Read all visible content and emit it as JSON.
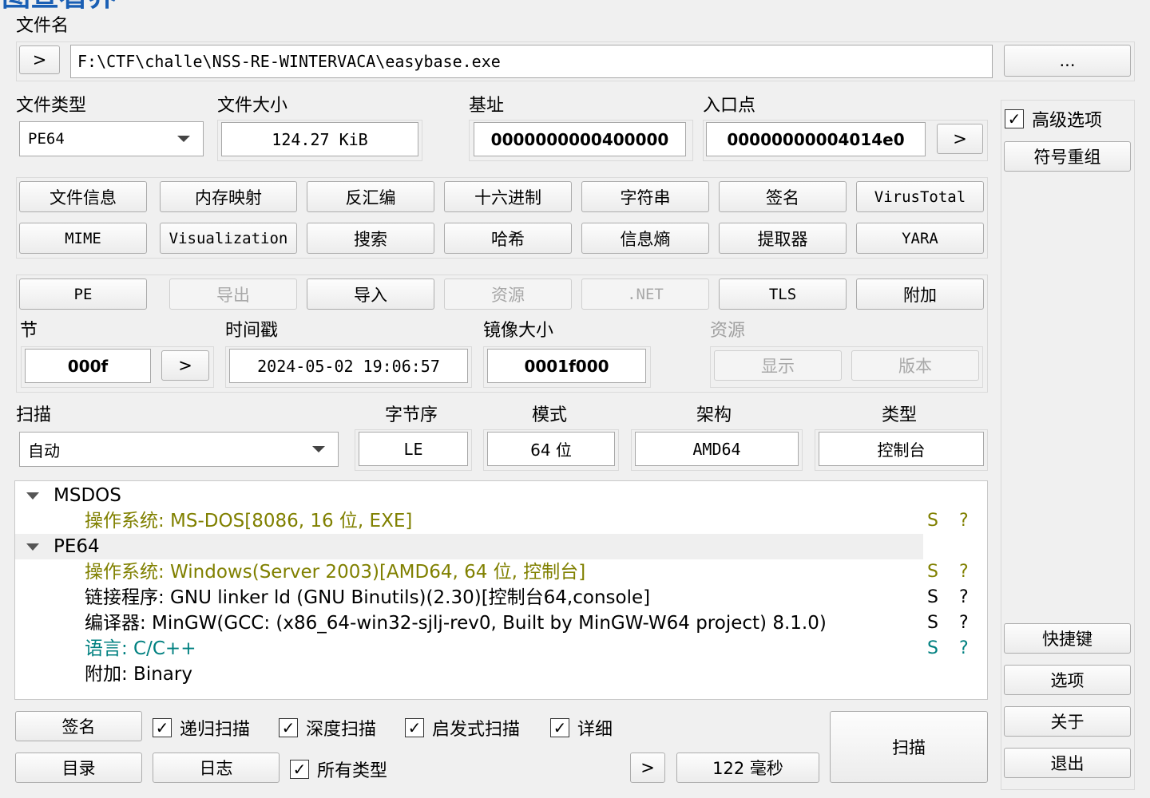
{
  "title_fragment": "图查看界",
  "file": {
    "label": "文件名",
    "expand_btn": ">",
    "path": "F:\\CTF\\challe\\NSS-RE-WINTERVACA\\easybase.exe",
    "browse_btn": "..."
  },
  "info": {
    "type_label": "文件类型",
    "type_value": "PE64",
    "size_label": "文件大小",
    "size_value": "124.27 KiB",
    "base_label": "基址",
    "base_value": "0000000000400000",
    "entry_label": "入口点",
    "entry_value": "00000000004014e0",
    "entry_btn": ">"
  },
  "tools": {
    "row1": [
      "文件信息",
      "内存映射",
      "反汇编",
      "十六进制",
      "字符串",
      "签名",
      "VirusTotal"
    ],
    "row2": [
      "MIME",
      "Visualization",
      "搜索",
      "哈希",
      "信息熵",
      "提取器",
      "YARA"
    ]
  },
  "pe": {
    "tabs": [
      "PE",
      "导出",
      "导入",
      "资源",
      ".NET",
      "TLS",
      "附加"
    ],
    "section_label": "节",
    "section_value": "000f",
    "section_btn": ">",
    "timestamp_label": "时间戳",
    "timestamp_value": "2024-05-02 19:06:57",
    "image_size_label": "镜像大小",
    "image_size_value": "0001f000",
    "resources_label": "资源",
    "resources_show": "显示",
    "resources_version": "版本"
  },
  "scan": {
    "label": "扫描",
    "mode_value": "自动",
    "endian_label": "字节序",
    "endian_value": "LE",
    "mode_label": "模式",
    "bits_value": "64 位",
    "arch_label": "架构",
    "arch_value": "AMD64",
    "type_label": "类型",
    "type_value": "控制台"
  },
  "results": [
    {
      "kind": "group",
      "text": "MSDOS"
    },
    {
      "kind": "item",
      "text": "操作系统: MS-DOS[8086, 16 位, EXE]",
      "color": "#808000",
      "s": "S",
      "q": "?"
    },
    {
      "kind": "group",
      "text": "PE64"
    },
    {
      "kind": "item",
      "text": "操作系统: Windows(Server 2003)[AMD64, 64 位, 控制台]",
      "color": "#808000",
      "s": "S",
      "q": "?"
    },
    {
      "kind": "item",
      "text": "链接程序: GNU linker ld (GNU Binutils)(2.30)[控制台64,console]",
      "color": "#000000",
      "s": "S",
      "q": "?"
    },
    {
      "kind": "item",
      "text": "编译器: MinGW(GCC: (x86_64-win32-sjlj-rev0, Built by MinGW-W64 project) 8.1.0)",
      "color": "#000000",
      "s": "S",
      "q": "?"
    },
    {
      "kind": "item",
      "text": "语言: C/C++",
      "color": "#008080",
      "s": "S",
      "q": "?"
    },
    {
      "kind": "item",
      "text": "附加: Binary",
      "color": "#000000",
      "s": "",
      "q": ""
    }
  ],
  "bottom": {
    "signature_btn": "签名",
    "recursive_label": "递归扫描",
    "deep_label": "深度扫描",
    "heuristic_label": "启发式扫描",
    "verbose_label": "详细",
    "directory_btn": "目录",
    "log_btn": "日志",
    "alltypes_label": "所有类型",
    "time_btn": ">",
    "time_value": "122 毫秒",
    "scan_btn": "扫描"
  },
  "sidebar": {
    "advanced_label": "高级选项",
    "demangle_btn": "符号重组",
    "shortcuts_btn": "快捷键",
    "options_btn": "选项",
    "about_btn": "关于",
    "exit_btn": "退出"
  },
  "checks": {
    "advanced": "✓",
    "recursive": "✓",
    "deep": "✓",
    "heuristic": "✓",
    "verbose": "✓",
    "alltypes": "✓"
  }
}
